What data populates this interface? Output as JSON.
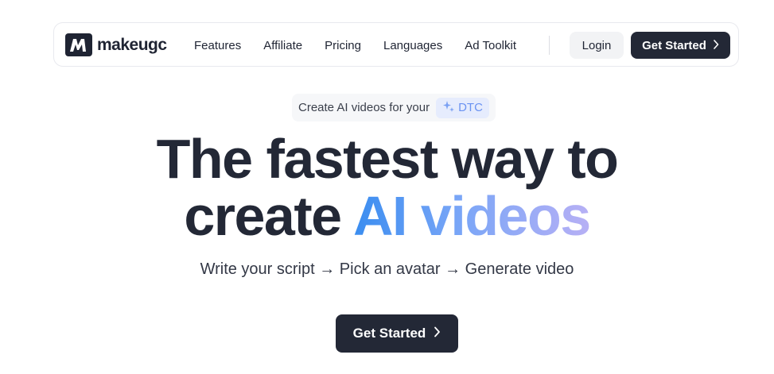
{
  "brand": {
    "name": "makeugc"
  },
  "nav": {
    "links": [
      "Features",
      "Affiliate",
      "Pricing",
      "Languages",
      "Ad Toolkit"
    ],
    "login_label": "Login",
    "cta_label": "Get Started"
  },
  "badge": {
    "text": "Create AI videos for your",
    "chip": "DTC"
  },
  "hero": {
    "line1": "The fastest way to",
    "line2_plain": "create",
    "line2_gradient": "AI videos",
    "subtitle": "Write your script → Pick an avatar → Generate video",
    "cta_label": "Get Started"
  },
  "colors": {
    "dark": "#232836",
    "accent_start": "#3a8df0",
    "accent_end": "#b7b0f5",
    "chip_bg": "#e6ecfd"
  }
}
